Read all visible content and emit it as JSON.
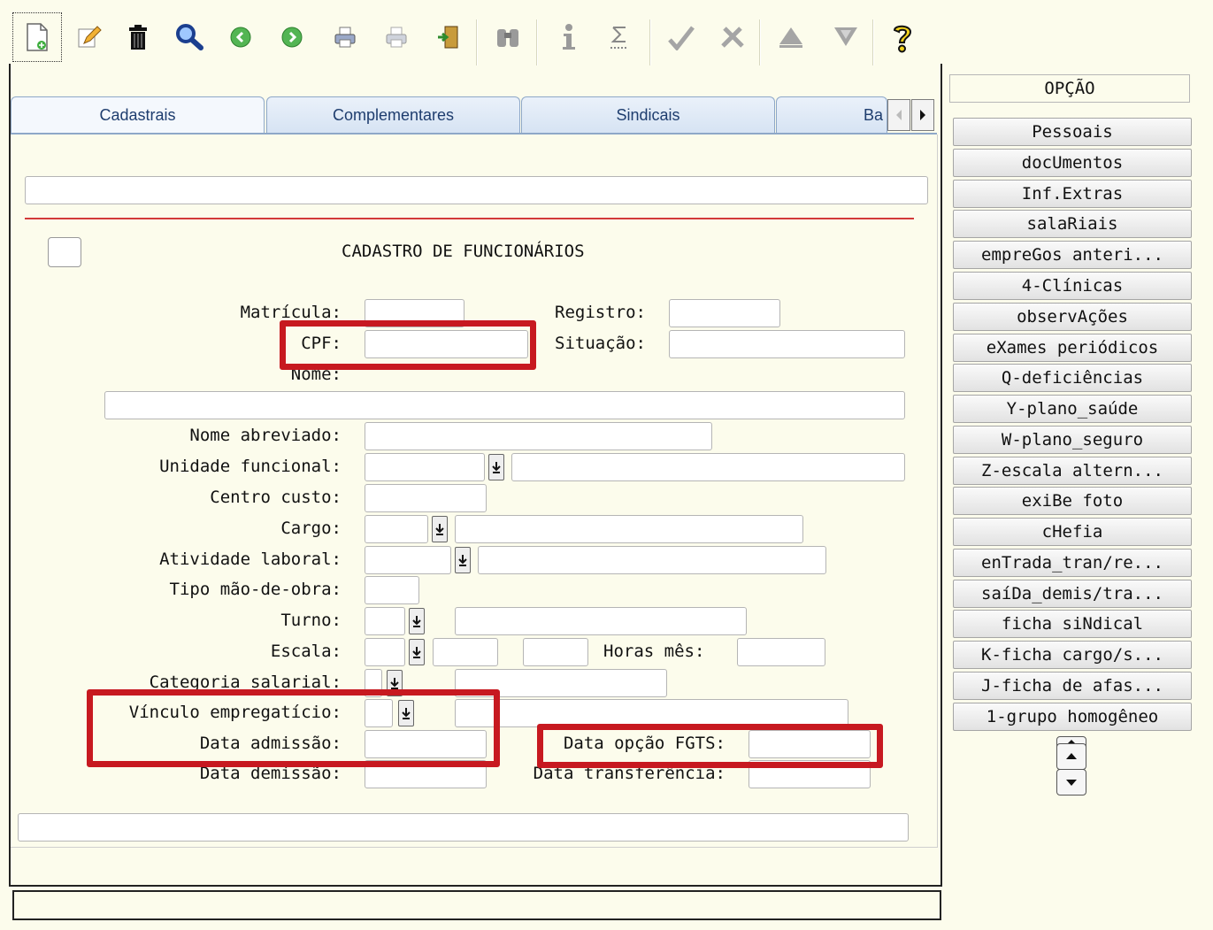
{
  "toolbar": {
    "icons": [
      "new-document-icon",
      "edit-pencil-icon",
      "trash-icon",
      "search-magnifier-icon",
      "previous-record-icon",
      "next-record-icon",
      "print-icon",
      "print-preview-icon",
      "exit-door-icon",
      "binoculars-icon",
      "info-icon",
      "sum-icon",
      "check-icon",
      "tools-icon",
      "up-triangle-icon",
      "down-triangle-icon",
      "help-question-icon"
    ]
  },
  "tabs": [
    {
      "label": "Cadastrais"
    },
    {
      "label": "Complementares"
    },
    {
      "label": "Sindicais"
    },
    {
      "label": "Ba"
    }
  ],
  "form": {
    "title": "CADASTRO DE FUNCIONÁRIOS",
    "matricula": {
      "label": "Matrícula:",
      "value": ""
    },
    "registro": {
      "label": "Registro:",
      "value": ""
    },
    "cpf": {
      "label": "CPF:",
      "value": ""
    },
    "situacao": {
      "label": "Situação:",
      "value": ""
    },
    "nome": {
      "label": "Nome:",
      "value": ""
    },
    "nome_abreviado": {
      "label": "Nome abreviado:",
      "value": ""
    },
    "unidade_funcional": {
      "label": "Unidade funcional:",
      "value": ""
    },
    "centro_custo": {
      "label": "Centro custo:",
      "value": ""
    },
    "cargo": {
      "label": "Cargo:",
      "value": ""
    },
    "atividade_laboral": {
      "label": "Atividade laboral:",
      "value": ""
    },
    "tipo_mao_obra": {
      "label": "Tipo mão-de-obra:",
      "value": ""
    },
    "turno": {
      "label": "Turno:",
      "value": ""
    },
    "escala": {
      "label": "Escala:",
      "value": ""
    },
    "horas_mes": {
      "label": "Horas mês:",
      "value": ""
    },
    "categoria_salarial": {
      "label": "Categoria salarial:",
      "value": ""
    },
    "vinculo": {
      "label": "Vínculo empregatício:",
      "value": ""
    },
    "data_admissao": {
      "label": "Data admissão:",
      "value": ""
    },
    "data_opcao_fgts": {
      "label": "Data opção FGTS:",
      "value": ""
    },
    "data_demissao": {
      "label": "Data demissão:",
      "value": ""
    },
    "data_transferencia": {
      "label": "Data transferência:",
      "value": ""
    }
  },
  "side": {
    "header": "OPÇÃO",
    "buttons": [
      "Pessoais",
      "docUmentos",
      "Inf.Extras",
      "salaRiais",
      "empreGos anteri...",
      "4-Clínicas",
      "observAções",
      "eXames periódicos",
      "Q-deficiências",
      "Y-plano_saúde",
      "W-plano_seguro",
      "Z-escala altern...",
      "exiBe foto",
      "cHefia",
      "enTrada_tran/re...",
      "saíDa_demis/tra...",
      "ficha siNdical",
      "K-ficha cargo/s...",
      "J-ficha de afas...",
      "1-grupo homogêneo"
    ]
  },
  "colors": {
    "highlight": "#c71920",
    "divider": "#d23a3a",
    "background": "#fcfcec"
  }
}
